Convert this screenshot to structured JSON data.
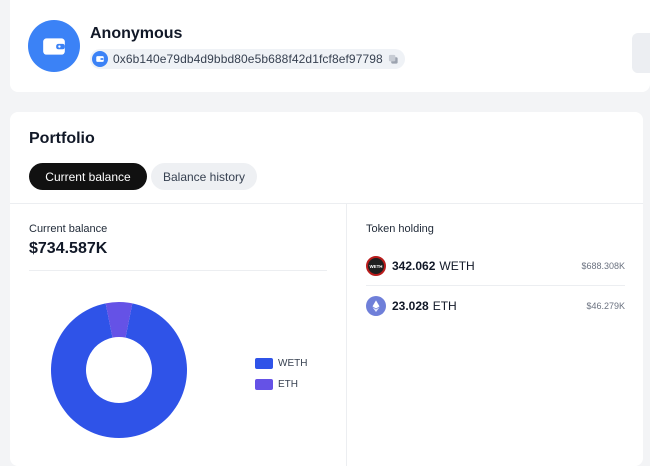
{
  "header": {
    "account_name": "Anonymous",
    "address": "0x6b140e79db4d9bbd80e5b688f42d1fcf8ef97798",
    "avatar_icon": "wallet-icon",
    "chain_icon": "wallet-icon",
    "copy_icon": "copy-icon",
    "accent_color": "#3b82f6"
  },
  "portfolio": {
    "title": "Portfolio",
    "tabs": [
      {
        "label": "Current balance",
        "active": true
      },
      {
        "label": "Balance history",
        "active": false
      }
    ],
    "balance": {
      "label": "Current balance",
      "value": "$734.587K"
    },
    "holdings_title": "Token holding",
    "tokens": [
      {
        "amount": "342.062",
        "symbol": "WETH",
        "value": "$688.308K",
        "icon": "weth-icon",
        "icon_text": "WETH"
      },
      {
        "amount": "23.028",
        "symbol": "ETH",
        "value": "$46.279K",
        "icon": "eth-icon"
      }
    ]
  },
  "chart_data": {
    "type": "pie",
    "style": "donut",
    "categories": [
      "WETH",
      "ETH"
    ],
    "values": [
      688.308,
      46.279
    ],
    "colors": [
      "#2f53e8",
      "#6552e6"
    ],
    "legend_placement": "right"
  }
}
